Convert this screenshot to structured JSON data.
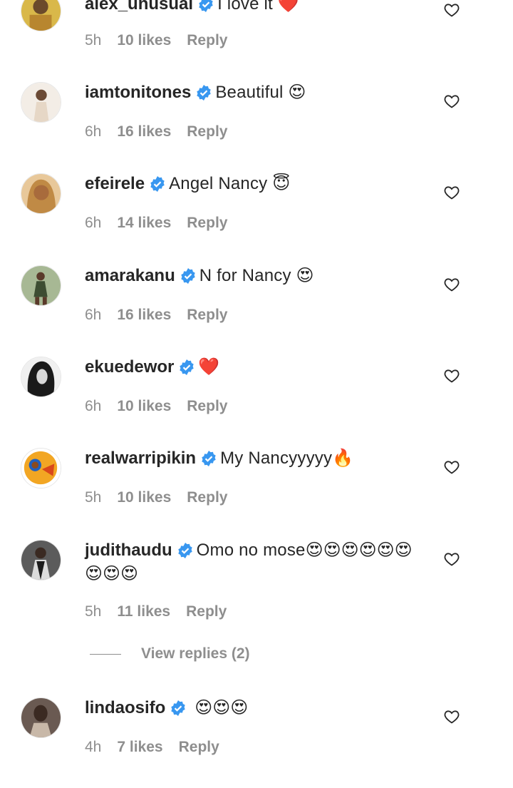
{
  "comments": [
    {
      "username": "alex_unusual",
      "text": "I love it ",
      "emoji": "❤️",
      "time": "5h",
      "likes": "10 likes",
      "reply": "Reply",
      "avatar_color": "#d9b84a"
    },
    {
      "username": "iamtonitones",
      "text": "Beautiful ",
      "emoji": "😍",
      "time": "6h",
      "likes": "16 likes",
      "reply": "Reply",
      "avatar_color": "#e8ddd0"
    },
    {
      "username": "efeirele",
      "text": "Angel Nancy ",
      "emoji": "😇",
      "time": "6h",
      "likes": "14 likes",
      "reply": "Reply",
      "avatar_color": "#c99a5b"
    },
    {
      "username": "amarakanu",
      "text": "N for Nancy ",
      "emoji": "😍",
      "time": "6h",
      "likes": "16 likes",
      "reply": "Reply",
      "avatar_color": "#6f8a5a"
    },
    {
      "username": "ekuedewor",
      "text": "",
      "emoji": "❤️",
      "time": "6h",
      "likes": "10 likes",
      "reply": "Reply",
      "avatar_color": "#2b2b2b"
    },
    {
      "username": "realwarripikin",
      "text": "My Nancyyyyy",
      "emoji": "🔥",
      "time": "5h",
      "likes": "10 likes",
      "reply": "Reply",
      "avatar_color": "#f2a623"
    },
    {
      "username": "judithaudu",
      "text": "Omo no mose",
      "emoji": "😍😍😍😍😍😍😍😍😍",
      "time": "5h",
      "likes": "11 likes",
      "reply": "Reply",
      "avatar_color": "#3a3a3a"
    },
    {
      "username": "lindaosifo",
      "text": " ",
      "emoji": "😍😍😍",
      "time": "4h",
      "likes": "7 likes",
      "reply": "Reply",
      "avatar_color": "#4a3a33"
    }
  ],
  "view_replies": "View replies (2)",
  "colors": {
    "verified": "#3897f0",
    "muted": "#8e8e8e",
    "text": "#262626"
  }
}
